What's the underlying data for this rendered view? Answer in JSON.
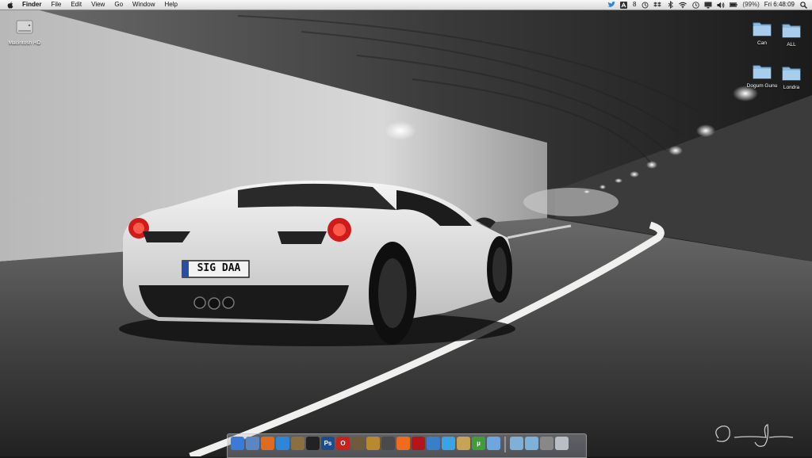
{
  "menubar": {
    "app_name": "Finder",
    "menus": [
      "File",
      "Edit",
      "View",
      "Go",
      "Window",
      "Help"
    ],
    "status": {
      "badge_count": "8",
      "battery": "(99%)",
      "clock": "Fri 6:48:09"
    }
  },
  "desktop": {
    "icons": [
      {
        "label": "Macintosh HD",
        "icon": "hard-drive-icon"
      },
      {
        "label": "Can",
        "icon": "folder-icon"
      },
      {
        "label": "ALL",
        "icon": "folder-icon"
      },
      {
        "label": "Dogum Gunu",
        "icon": "folder-icon"
      },
      {
        "label": "Londra",
        "icon": "folder-icon"
      }
    ]
  },
  "license_plate": "SIG DAA",
  "dock": {
    "apps": [
      {
        "name": "finder-icon",
        "color": "#3b7ad8",
        "glyph": ""
      },
      {
        "name": "mail-icon",
        "color": "#5a86c4",
        "glyph": ""
      },
      {
        "name": "firefox-icon",
        "color": "#e06b1f",
        "glyph": ""
      },
      {
        "name": "safari-icon",
        "color": "#2f86d8",
        "glyph": ""
      },
      {
        "name": "iphoto-icon",
        "color": "#8c6f3f",
        "glyph": ""
      },
      {
        "name": "dvd-player-icon",
        "color": "#222222",
        "glyph": ""
      },
      {
        "name": "photoshop-icon",
        "color": "#1d4c8a",
        "glyph": "Ps"
      },
      {
        "name": "opera-icon",
        "color": "#c9221e",
        "glyph": "O"
      },
      {
        "name": "game-icon",
        "color": "#6e5b3a",
        "glyph": ""
      },
      {
        "name": "guitar-icon",
        "color": "#b8892f",
        "glyph": ""
      },
      {
        "name": "steam-icon",
        "color": "#4a4a4a",
        "glyph": ""
      },
      {
        "name": "soundcloud-icon",
        "color": "#f26b1d",
        "glyph": ""
      },
      {
        "name": "record-icon",
        "color": "#b5141a",
        "glyph": ""
      },
      {
        "name": "app-store-icon",
        "color": "#3a7dc9",
        "glyph": ""
      },
      {
        "name": "twitter-icon",
        "color": "#3aa3e3",
        "glyph": ""
      },
      {
        "name": "archive-icon",
        "color": "#c7a455",
        "glyph": ""
      },
      {
        "name": "utorrent-icon",
        "color": "#3f9e3a",
        "glyph": "µ"
      },
      {
        "name": "messages-icon",
        "color": "#6fa6e0",
        "glyph": ""
      },
      {
        "name": "downloads-folder-icon",
        "color": "#7fb0d8",
        "glyph": ""
      },
      {
        "name": "documents-folder-icon",
        "color": "#7fb0d8",
        "glyph": ""
      },
      {
        "name": "network-icon",
        "color": "#888888",
        "glyph": ""
      },
      {
        "name": "trash-icon",
        "color": "#b9bec6",
        "glyph": ""
      }
    ]
  }
}
